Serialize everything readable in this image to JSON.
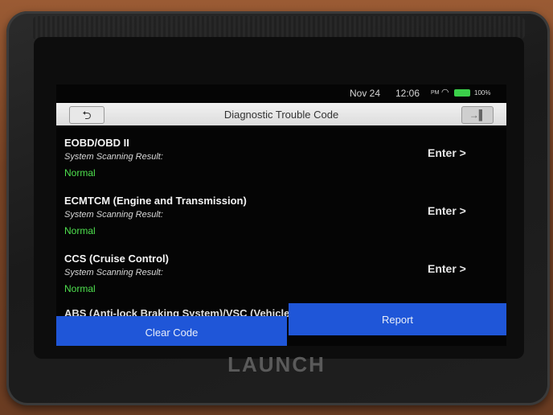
{
  "status_bar": {
    "date": "Nov 24",
    "time": "12:06",
    "ampm": "PM",
    "battery": "100%",
    "icons": [
      "wifi-icon",
      "battery-icon"
    ]
  },
  "header": {
    "title": "Diagnostic Trouble Code",
    "back_icon": "back-arrow-icon",
    "exit_icon": "exit-icon"
  },
  "systems": [
    {
      "name": "EOBD/OBD II",
      "result_label": "System Scanning Result:",
      "status": "Normal",
      "action": "Enter >"
    },
    {
      "name": "ECMTCM (Engine and Transmission)",
      "result_label": "System Scanning Result:",
      "status": "Normal",
      "action": "Enter >"
    },
    {
      "name": "CCS (Cruise Control)",
      "result_label": "System Scanning Result:",
      "status": "Normal",
      "action": "Enter >"
    }
  ],
  "partial_item": "ABS (Anti-lock Braking System)/VSC (Vehicle Stability Control)/",
  "buttons": {
    "clear": "Clear Code",
    "report": "Report"
  },
  "device_brand": "LAUNCH",
  "colors": {
    "accent": "#1f56d8",
    "status_ok": "#4ee04e"
  }
}
